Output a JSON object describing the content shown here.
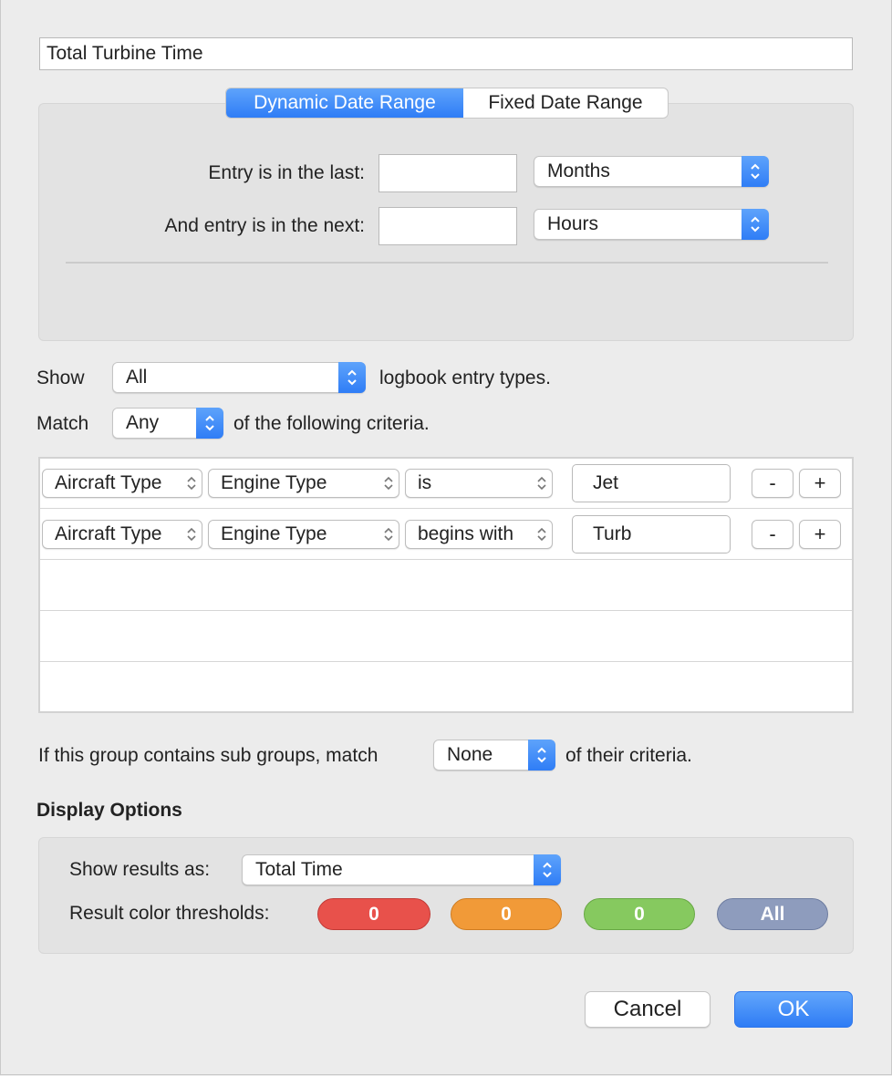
{
  "group_name": "Total Turbine Time",
  "date_range": {
    "tabs": [
      {
        "label": "Dynamic Date Range",
        "selected": true
      },
      {
        "label": "Fixed Date Range",
        "selected": false
      }
    ],
    "last_label": "Entry is in the last:",
    "last_value": "",
    "last_unit": "Months",
    "next_label": "And entry is in the next:",
    "next_value": "",
    "next_unit": "Hours"
  },
  "show": {
    "label": "Show",
    "value": "All",
    "suffix": "logbook entry types."
  },
  "match": {
    "label": "Match",
    "value": "Any",
    "suffix": "of the following criteria."
  },
  "criteria": [
    {
      "field": "Aircraft Type",
      "property": "Engine Type",
      "operator": "is",
      "value": "Jet",
      "remove": "-",
      "add": "+"
    },
    {
      "field": "Aircraft Type",
      "property": "Engine Type",
      "operator": "begins with",
      "value": "Turb",
      "remove": "-",
      "add": "+"
    }
  ],
  "subgroups": {
    "prefix": "If this group contains sub groups, match",
    "value": "None",
    "suffix": "of their criteria."
  },
  "display_options": {
    "heading": "Display Options",
    "results_label": "Show results as:",
    "results_value": "Total Time",
    "thresholds_label": "Result color thresholds:",
    "thresholds": [
      {
        "label": "0",
        "color": "#e8514b"
      },
      {
        "label": "0",
        "color": "#f19a38"
      },
      {
        "label": "0",
        "color": "#86c95f"
      },
      {
        "label": "All",
        "color": "#8e9cbd"
      }
    ]
  },
  "buttons": {
    "cancel": "Cancel",
    "ok": "OK"
  },
  "colors": {
    "accent": "#2f7df6"
  }
}
